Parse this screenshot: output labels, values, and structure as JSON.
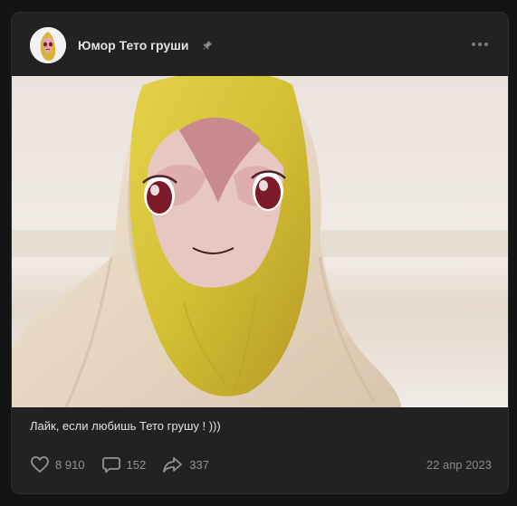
{
  "post": {
    "group_name": "Юмор Тето груши",
    "caption": "Лайк, если любишь Тето грушу ! )))",
    "likes": "8 910",
    "comments": "152",
    "shares": "337",
    "date": "22 апр 2023",
    "icons": {
      "avatar": "pear-character-avatar",
      "pin": "pin-icon",
      "more": "more-dots-icon",
      "like": "heart-icon",
      "comment": "comment-icon",
      "share": "share-icon"
    }
  },
  "colors": {
    "background": "#141414",
    "card": "#222222",
    "text": "#e1e3e6",
    "muted": "#939393"
  }
}
